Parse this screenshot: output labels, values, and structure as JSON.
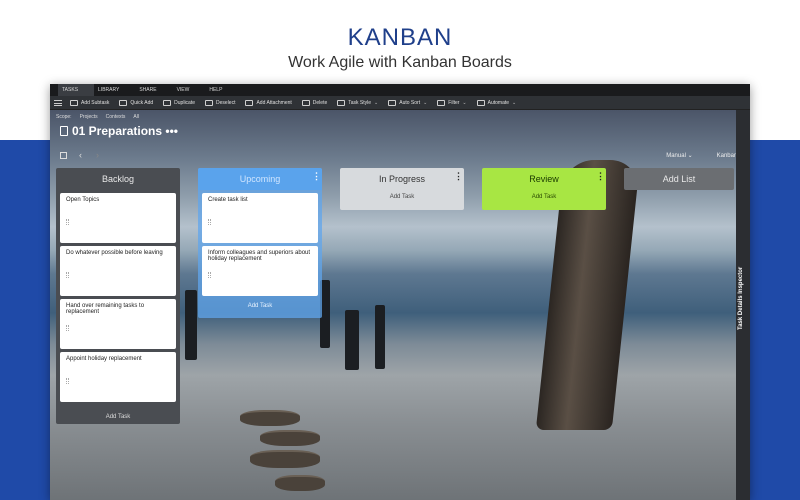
{
  "hero": {
    "title": "KANBAN",
    "subtitle": "Work Agile with Kanban Boards"
  },
  "menubar": [
    "TASKS",
    "LIBRARY",
    "SHARE",
    "VIEW",
    "HELP"
  ],
  "toolbar": {
    "add_subtask": "Add Subtask",
    "quick_add": "Quick Add",
    "duplicate": "Duplicate",
    "deselect": "Deselect",
    "add_attachment": "Add Attachment",
    "delete": "Delete",
    "task_style": "Task Style",
    "auto_sort": "Auto Sort",
    "filter": "Filter",
    "automate": "Automate"
  },
  "scope": {
    "label": "Scope:",
    "items": [
      "Projects",
      "Contexts",
      "All"
    ]
  },
  "project": {
    "title": "01 Preparations •••"
  },
  "view_controls": {
    "sort": "Manual",
    "view": "Kanban"
  },
  "columns": {
    "backlog": {
      "title": "Backlog",
      "cards": [
        "Open Topics",
        "Do whatever possible before leaving",
        "Hand over remaining tasks to replacement",
        "Appoint holiday replacement"
      ],
      "add_task": "Add Task"
    },
    "upcoming": {
      "title": "Upcoming",
      "cards": [
        "Create task list",
        "Inform colleagues and superiors about holiday replacement"
      ],
      "add_task": "Add Task"
    },
    "in_progress": {
      "title": "In Progress",
      "add_task": "Add Task"
    },
    "review": {
      "title": "Review",
      "add_task": "Add Task"
    },
    "add_list": {
      "title": "Add List"
    }
  },
  "inspector": {
    "label": "Task Details Inspector"
  },
  "colors": {
    "blue_band": "#1f4aa8",
    "upcoming": "#5aa3ec",
    "review": "#a8e643"
  }
}
